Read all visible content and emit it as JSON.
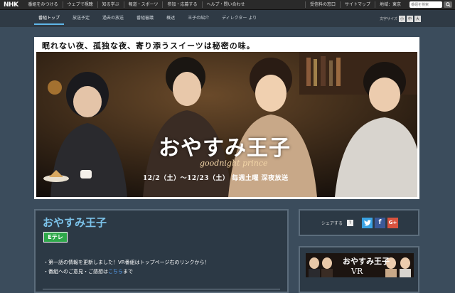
{
  "global_nav": {
    "logo": "NHK",
    "items": [
      "番組をみつける",
      "ウェブで視聴",
      "知る学ぶ",
      "報道・スポーツ",
      "参加・応募する",
      "ヘルプ・問い合わせ"
    ],
    "right_items": [
      "受信料の窓口",
      "サイトマップ",
      "地域：東京"
    ],
    "search_placeholder": "番組を検索"
  },
  "program_nav": {
    "tabs": [
      "番組トップ",
      "放送予定",
      "過去の放送",
      "番組審議",
      "概述",
      "王子の紹介",
      "ディレクター より"
    ],
    "font_size_label": "文字サイズ",
    "font_buttons": [
      "小",
      "中",
      "大"
    ]
  },
  "hero": {
    "headline": "眠れない夜、孤独な夜、寄り添うスイーツは秘密の味。",
    "title": "おやすみ王子",
    "subtitle": "goodnight prince",
    "date": "12/2（土）～12/23（土） 毎週土曜 深夜放送"
  },
  "main": {
    "title": "おやすみ王子",
    "channel_badge": "Eテレ",
    "notices": [
      "・第一話の情報を更新しました！VR番組はトップページ右のリンクから！"
    ],
    "feedback_prefix": "・番組へのご意見・ご感想は",
    "feedback_link": "こちら",
    "feedback_suffix": "まで"
  },
  "share": {
    "label": "シェアする",
    "help": "?",
    "twitter": "t",
    "facebook": "f",
    "google": "G+"
  },
  "vr_banner": {
    "title": "おやすみ王子",
    "text": "VR"
  },
  "colors": {
    "accent": "#7cc3ea",
    "channel": "#2ea84a",
    "background": "#3b4c5c",
    "panel": "#2c3945"
  }
}
